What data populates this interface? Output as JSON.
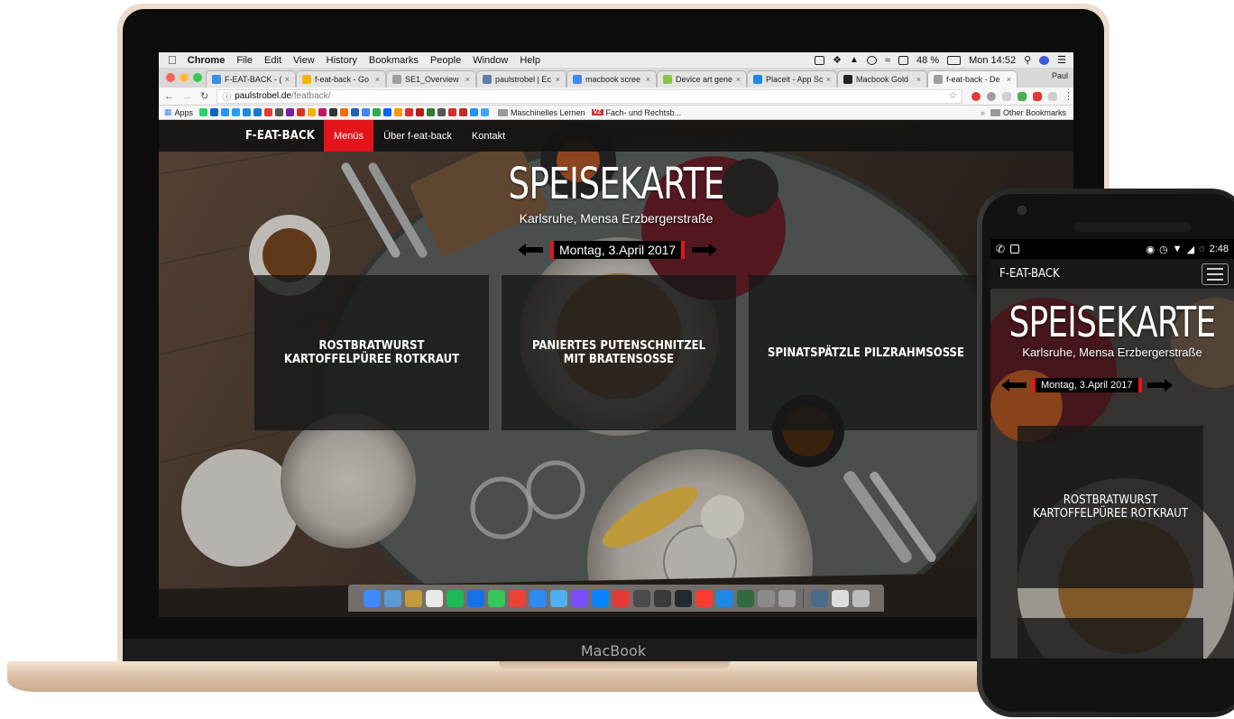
{
  "device_laptop": {
    "label": "MacBook"
  },
  "mac_menubar": {
    "app": "Chrome",
    "items": [
      "File",
      "Edit",
      "View",
      "History",
      "Bookmarks",
      "People",
      "Window",
      "Help"
    ],
    "battery": "48 %",
    "clock": "Mon 14:52"
  },
  "browser": {
    "tabs": [
      {
        "title": "F-EAT-BACK - (",
        "color": "#3a8ee6"
      },
      {
        "title": "f-eat-back - Go",
        "color": "#f4b400"
      },
      {
        "title": "SE1_Overview",
        "color": "#9e9e9e"
      },
      {
        "title": "paulstrobel | Ec",
        "color": "#5f7ea9"
      },
      {
        "title": "macbook scree",
        "color": "#4285f4"
      },
      {
        "title": "Device art gene",
        "color": "#8bc34a"
      },
      {
        "title": "Placeit - App Sc",
        "color": "#1e88e5"
      },
      {
        "title": "Macbook Gold",
        "color": "#212121"
      },
      {
        "title": "f-eat-back - De",
        "color": "#9e9e9e"
      }
    ],
    "profile": "Paul",
    "url_host": "paulstrobel.de",
    "url_path": "/featback/",
    "bookmarks": {
      "apps": "Apps",
      "folder_1": "Maschinelles Lernen",
      "vz_badge": "VZ",
      "folder_2": "Fach- und Rechtsb...",
      "more": "»",
      "other": "Other Bookmarks"
    }
  },
  "site": {
    "brand": "F-EAT-BACK",
    "nav": [
      "Menüs",
      "Über f-eat-back",
      "Kontakt"
    ],
    "title": "SPEISEKARTE",
    "subtitle": "Karlsruhe, Mensa Erzbergerstraße",
    "date": "Montag, 3.April 2017",
    "menus": [
      "ROSTBRATWURST KARTOFFELPÜREE ROTKRAUT",
      "PANIERTES PUTENSCHNITZEL MIT BRATENSOSSE",
      "SPINATSPÄTZLE PILZRAHMSOSSE"
    ]
  },
  "phone": {
    "time": "2:48",
    "brand": "F-EAT-BACK",
    "title": "SPEISEKARTE",
    "subtitle": "Karlsruhe, Mensa Erzbergerstraße",
    "date": "Montag, 3.April 2017",
    "menu_1": "ROSTBRATWURST KARTOFFELPÜREE ROTKRAUT"
  },
  "colors": {
    "accent_red": "#e3141b",
    "laptop_gold": "#eddccb",
    "card_bg": "rgba(24,24,24,0.82)"
  }
}
